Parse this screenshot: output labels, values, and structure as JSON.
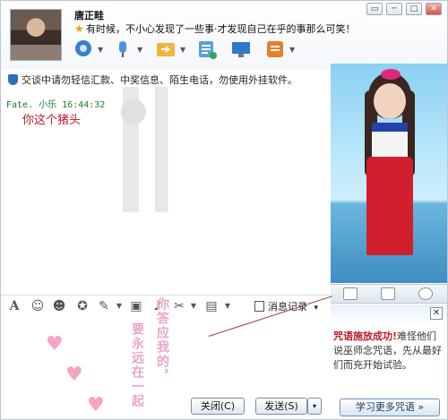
{
  "window": {
    "title_controls": [
      "▭",
      "─",
      "□",
      "✕"
    ]
  },
  "contact": {
    "nickname": "唐正畦",
    "signature": "有时候，不小心发现了一些事·才发现自己在乎的事那么可笑！"
  },
  "toolbar": {
    "icons": [
      "video-call-icon",
      "voice-call-icon",
      "file-transfer-icon",
      "app-list-icon",
      "remote-assist-icon",
      "more-apps-icon"
    ]
  },
  "warning": {
    "text": "交谈中请勿轻信汇款、中奖信息、陌生电话，勿使用外挂软件。"
  },
  "chat": {
    "message_meta": "Fate.  小乐  16:44:32",
    "message_text": "你这个猪头"
  },
  "format_bar": {
    "history_label": "消息记录",
    "history_arrow": "▾"
  },
  "input": {
    "decoration_text_left": "要永远在一起",
    "decoration_text_right": "你答应我的，"
  },
  "buttons": {
    "close_label": "关闭(C)",
    "send_label": "发送(S)",
    "send_arrow": "▾"
  },
  "ad": {
    "close_symbol": "✕",
    "headline": "咒语施放成功!",
    "body": "难怪他们说巫师念咒语，先从最好们而充开始试验。",
    "more_label": "学习更多咒语 »"
  }
}
